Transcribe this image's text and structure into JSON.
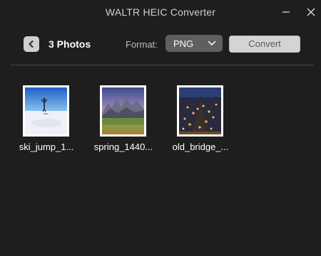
{
  "window": {
    "title": "WALTR HEIC Converter"
  },
  "toolbar": {
    "count_label": "3 Photos",
    "format_label": "Format:",
    "format_value": "PNG",
    "convert_label": "Convert"
  },
  "photos": [
    {
      "name": "ski_jump_1...",
      "scene": "snowy-field-person"
    },
    {
      "name": "spring_1440...",
      "scene": "mountain-meadow"
    },
    {
      "name": "old_bridge_...",
      "scene": "city-night"
    }
  ],
  "colors": {
    "background": "#1e1e1f",
    "select_bg": "#5f5f62",
    "convert_bg": "#d4d4d4"
  },
  "icons": {
    "back": "chevron-left-icon",
    "minimize": "minimize-icon",
    "close": "close-icon",
    "dropdown": "chevron-down-icon"
  }
}
